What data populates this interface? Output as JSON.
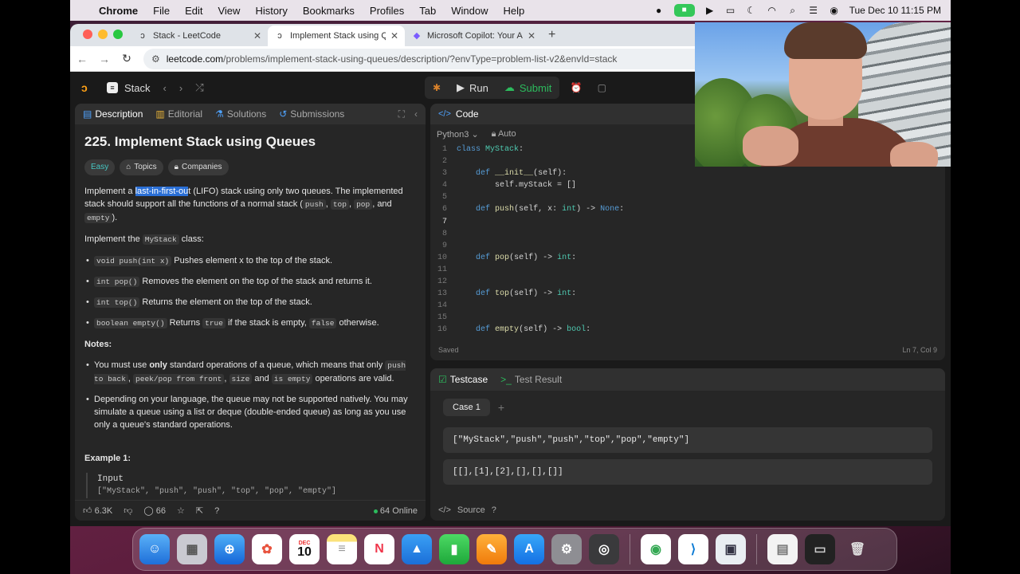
{
  "menubar": {
    "app": "Chrome",
    "items": [
      "File",
      "Edit",
      "View",
      "History",
      "Bookmarks",
      "Profiles",
      "Tab",
      "Window",
      "Help"
    ],
    "clock": "Tue Dec 10  11:15 PM"
  },
  "browser": {
    "tabs": [
      {
        "title": "Stack - LeetCode",
        "active": false
      },
      {
        "title": "Implement Stack using Queues",
        "active": true
      },
      {
        "title": "Microsoft Copilot: Your AI com",
        "active": false
      }
    ],
    "url_host": "leetcode.com",
    "url_path": "/problems/implement-stack-using-queues/description/?envType=problem-list-v2&envId=stack"
  },
  "lc_top": {
    "list_name": "Stack",
    "run_label": "Run",
    "submit_label": "Submit"
  },
  "description": {
    "tabs": [
      "Description",
      "Editorial",
      "Solutions",
      "Submissions"
    ],
    "title": "225. Implement Stack using Queues",
    "chips": {
      "difficulty": "Easy",
      "topics": "Topics",
      "companies": "Companies"
    },
    "p1_pre": "Implement a ",
    "p1_hl": "last-in-first-ou",
    "p1_post": "t (LIFO) stack using only two queues. The implemented stack should support all the functions of a normal stack (",
    "p1_c1": "push",
    "p1_c2": "top",
    "p1_c3": "pop",
    "p1_and": ", and",
    "p1_c4": "empty",
    "p1_end": ").",
    "p2_pre": "Implement the ",
    "p2_code": "MyStack",
    "p2_post": " class:",
    "methods": [
      {
        "code": "void push(int x)",
        "text": " Pushes element x to the top of the stack."
      },
      {
        "code": "int pop()",
        "text": " Removes the element on the top of the stack and returns it."
      },
      {
        "code": "int top()",
        "text": " Returns the element on the top of the stack."
      },
      {
        "code": "boolean empty()",
        "text": " Returns "
      }
    ],
    "m4_true": "true",
    "m4_mid": " if the stack is empty, ",
    "m4_false": "false",
    "m4_end": " otherwise.",
    "notes_label": "Notes:",
    "note1_pre": "You must use ",
    "note1_bold": "only",
    "note1_mid": " standard operations of a queue, which means that only ",
    "note1_c1": "push to back",
    "note1_c2": "peek/pop from front",
    "note1_c3": "size",
    "note1_and": " and ",
    "note1_c4": "is empty",
    "note1_end": " operations are valid.",
    "note2": "Depending on your language, the queue may not be supported natively. You may simulate a queue using a list or deque (double-ended queue) as long as you use only a queue's standard operations.",
    "example_label": "Example 1:",
    "example_input_label": "Input",
    "example_input": "[\"MyStack\", \"push\", \"push\", \"top\", \"pop\", \"empty\"]",
    "likes": "6.3K",
    "comments": "66",
    "online": "64 Online"
  },
  "code": {
    "header": "Code",
    "language": "Python3",
    "mode": "Auto",
    "saved": "Saved",
    "cursor": "Ln 7, Col 9",
    "lines": [
      "1",
      "2",
      "3",
      "4",
      "5",
      "6",
      "7",
      "8",
      "9",
      "10",
      "11",
      "12",
      "13",
      "14",
      "15",
      "16"
    ],
    "code_lines": [
      "class MyStack:",
      "",
      "    def __init__(self):",
      "        self.myStack = []",
      "",
      "    def push(self, x: int) -> None:",
      "",
      "",
      "",
      "    def pop(self) -> int:",
      "",
      "",
      "    def top(self) -> int:",
      "",
      "",
      "    def empty(self) -> bool:"
    ]
  },
  "testcase": {
    "tab1": "Testcase",
    "tab2": "Test Result",
    "case": "Case 1",
    "input1": "[\"MyStack\",\"push\",\"push\",\"top\",\"pop\",\"empty\"]",
    "input2": "[[],[1],[2],[],[],[]]",
    "source": "Source"
  },
  "dock": {
    "calendar_month": "DEC",
    "calendar_day": "10"
  }
}
